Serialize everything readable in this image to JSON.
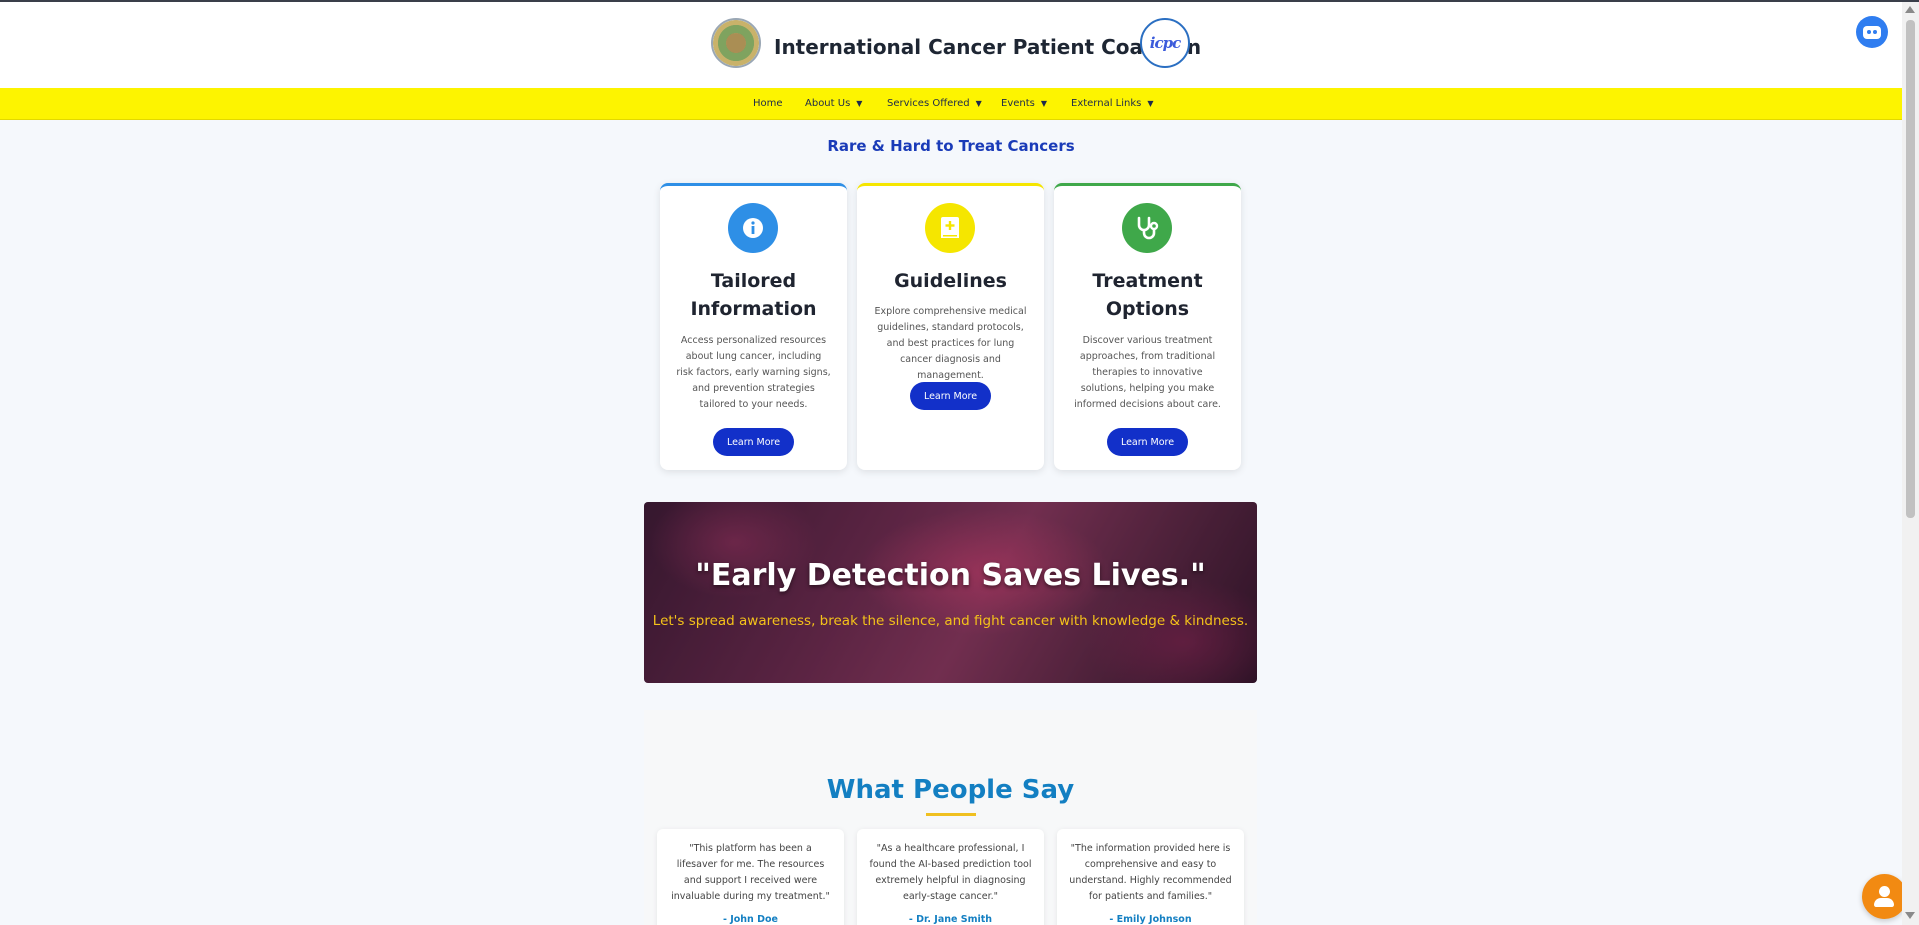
{
  "site": {
    "title": "International Cancer Patient Coalition",
    "right_logo_text": "icpc"
  },
  "nav": {
    "items": [
      {
        "label": "Home",
        "has_dropdown": false
      },
      {
        "label": "About Us",
        "has_dropdown": true
      },
      {
        "label": "Services Offered",
        "has_dropdown": true
      },
      {
        "label": "Events",
        "has_dropdown": true
      },
      {
        "label": "External Links",
        "has_dropdown": true
      }
    ],
    "caret": "▼"
  },
  "section": {
    "title": "Rare & Hard to Treat Cancers"
  },
  "cards": [
    {
      "icon": "info-icon",
      "title": "Tailored Information",
      "text": "Access personalized resources about lung cancer, including risk factors, early warning signs, and prevention strategies tailored to your needs.",
      "button": "Learn More",
      "accent": "#2e8fe6"
    },
    {
      "icon": "medical-book-icon",
      "title": "Guidelines",
      "text": "Explore comprehensive medical guidelines, standard protocols, and best practices for lung cancer diagnosis and management.",
      "button": "Learn More",
      "accent": "#f5e600"
    },
    {
      "icon": "stethoscope-icon",
      "title": "Treatment Options",
      "text": "Discover various treatment approaches, from traditional therapies to innovative solutions, helping you make informed decisions about care.",
      "button": "Learn More",
      "accent": "#3fa84a"
    }
  ],
  "banner": {
    "quote": "\"Early Detection Saves Lives.\"",
    "subtitle": "Let's spread awareness, break the silence, and fight cancer with knowledge & kindness."
  },
  "testimonials": {
    "title": "What People Say",
    "items": [
      {
        "quote": "\"This platform has been a lifesaver for me. The resources and support I received were invaluable during my treatment.\"",
        "author": "- John Doe"
      },
      {
        "quote": "\"As a healthcare professional, I found the AI-based prediction tool extremely helpful in diagnosing early-stage cancer.\"",
        "author": "- Dr. Jane Smith"
      },
      {
        "quote": "\"The information provided here is comprehensive and easy to understand. Highly recommended for patients and families.\"",
        "author": "- Emily Johnson"
      }
    ]
  },
  "colors": {
    "nav_bg": "#fdf400",
    "primary_button": "#1230c9",
    "section_title": "#1a3bb8",
    "testimonial_title": "#137fc2",
    "banner_subtitle": "#f4c21a",
    "chat_button": "#f28a12",
    "bot_button": "#2f7df0"
  },
  "widgets": {
    "bot_icon": "robot-icon",
    "chat_icon": "user-support-icon"
  }
}
